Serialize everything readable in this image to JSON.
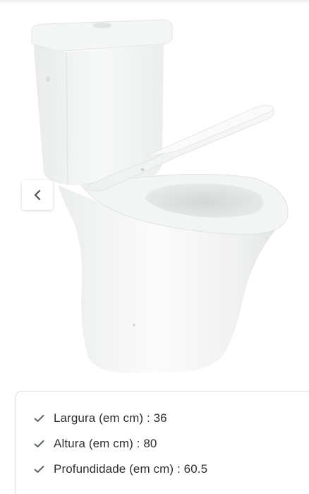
{
  "gallery": {
    "image_icon": "toilet-product-photo",
    "prev_icon": "chevron-left-icon"
  },
  "specs": [
    {
      "label": "Largura (em cm)",
      "separator": " : ",
      "value": "36"
    },
    {
      "label": "Altura (em cm)",
      "separator": " : ",
      "value": "80"
    },
    {
      "label": "Profundidade (em cm)",
      "separator": " : ",
      "value": "60.5"
    }
  ],
  "colors": {
    "check": "#5c6466",
    "text": "#2e2e2e",
    "card_border": "#d9dcdc"
  }
}
